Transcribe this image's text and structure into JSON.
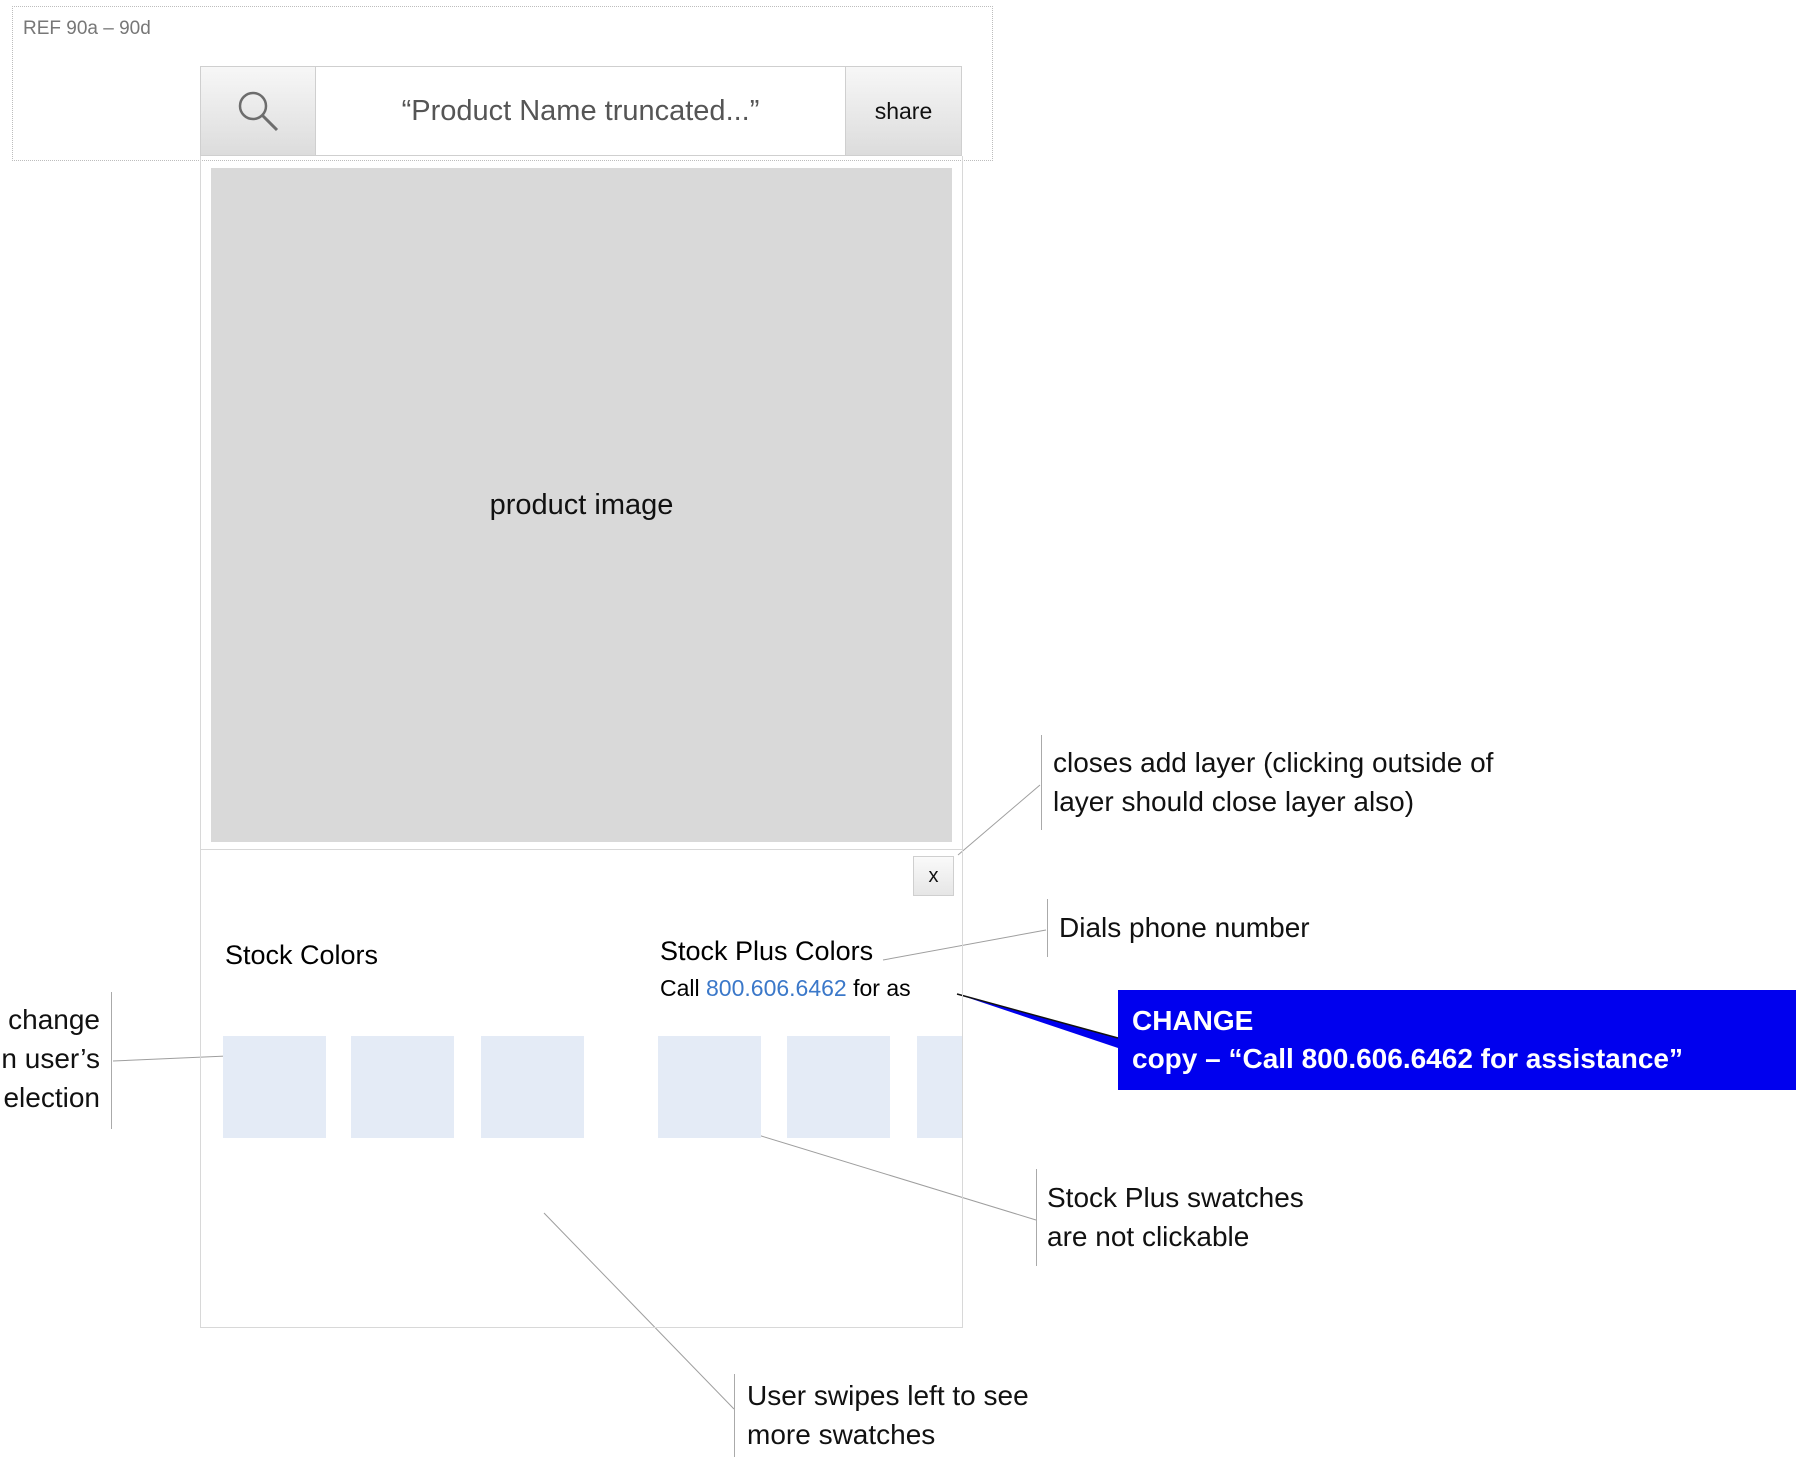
{
  "ref_label": "REF 90a – 90d",
  "topbar": {
    "search_icon": "search-icon",
    "title": "“Product Name truncated...”",
    "share_label": "share"
  },
  "product_image_label": "product image",
  "layer": {
    "close_label": "x",
    "stock_title": "Stock Colors",
    "plus_title": "Stock Plus Colors",
    "call_prefix": "Call ",
    "phone": "800.606.6462",
    "call_suffix": " for as"
  },
  "annotations": {
    "close": [
      "closes add layer (clicking outside of",
      "layer should close layer also)"
    ],
    "dial": "Dials phone number",
    "change_title": "CHANGE",
    "change_copy": "copy – “Call 800.606.6462 for assistance”",
    "selection": [
      "change",
      "n user’s",
      "election"
    ],
    "not_clickable": [
      "Stock Plus swatches",
      "are not clickable"
    ],
    "swipe": [
      "User swipes left to see",
      "more swatches"
    ]
  },
  "colors": {
    "swatch": "#e4ebf6",
    "image_placeholder": "#d9d9d9",
    "link": "#3b78c9",
    "callout": "#0000ee"
  }
}
